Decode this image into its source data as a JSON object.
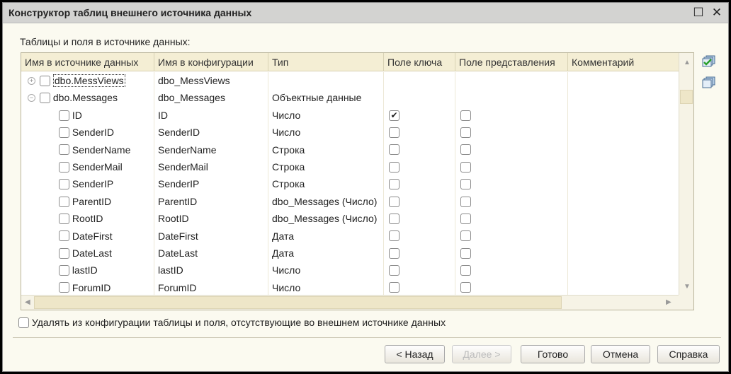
{
  "window": {
    "title": "Конструктор таблиц внешнего источника данных"
  },
  "label": "Таблицы и поля в источнике данных:",
  "columns": [
    "Имя в источнике данных",
    "Имя в конфигурации",
    "Тип",
    "Поле ключа",
    "Поле представления",
    "Комментарий"
  ],
  "rows": [
    {
      "level": 0,
      "expander": "+",
      "source": "dbo.MessViews",
      "config": "dbo_MessViews",
      "type": "",
      "checked": false,
      "key": null,
      "repr": null,
      "focused": true
    },
    {
      "level": 0,
      "expander": "−",
      "source": "dbo.Messages",
      "config": "dbo_Messages",
      "type": "Объектные данные",
      "checked": false,
      "key": null,
      "repr": null
    },
    {
      "level": 1,
      "source": "ID",
      "config": "ID",
      "type": "Число",
      "checked": false,
      "key": true,
      "repr": false
    },
    {
      "level": 1,
      "source": "SenderID",
      "config": "SenderID",
      "type": "Число",
      "checked": false,
      "key": false,
      "repr": false
    },
    {
      "level": 1,
      "source": "SenderName",
      "config": "SenderName",
      "type": "Строка",
      "checked": false,
      "key": false,
      "repr": false
    },
    {
      "level": 1,
      "source": "SenderMail",
      "config": "SenderMail",
      "type": "Строка",
      "checked": false,
      "key": false,
      "repr": false
    },
    {
      "level": 1,
      "source": "SenderIP",
      "config": "SenderIP",
      "type": "Строка",
      "checked": false,
      "key": false,
      "repr": false
    },
    {
      "level": 1,
      "source": "ParentID",
      "config": "ParentID",
      "type": "dbo_Messages (Число)",
      "checked": false,
      "key": false,
      "repr": false
    },
    {
      "level": 1,
      "source": "RootID",
      "config": "RootID",
      "type": "dbo_Messages (Число)",
      "checked": false,
      "key": false,
      "repr": false
    },
    {
      "level": 1,
      "source": "DateFirst",
      "config": "DateFirst",
      "type": "Дата",
      "checked": false,
      "key": false,
      "repr": false
    },
    {
      "level": 1,
      "source": "DateLast",
      "config": "DateLast",
      "type": "Дата",
      "checked": false,
      "key": false,
      "repr": false
    },
    {
      "level": 1,
      "source": "lastID",
      "config": "lastID",
      "type": "Число",
      "checked": false,
      "key": false,
      "repr": false
    },
    {
      "level": 1,
      "source": "ForumID",
      "config": "ForumID",
      "type": "Число",
      "checked": false,
      "key": false,
      "repr": false
    }
  ],
  "delete_option": {
    "label": "Удалять из конфигурации таблицы и поля, отсутствующие во внешнем источнике данных",
    "checked": false
  },
  "buttons": {
    "back": "< Назад",
    "next": "Далее >",
    "done": "Готово",
    "cancel": "Отмена",
    "help": "Справка"
  }
}
